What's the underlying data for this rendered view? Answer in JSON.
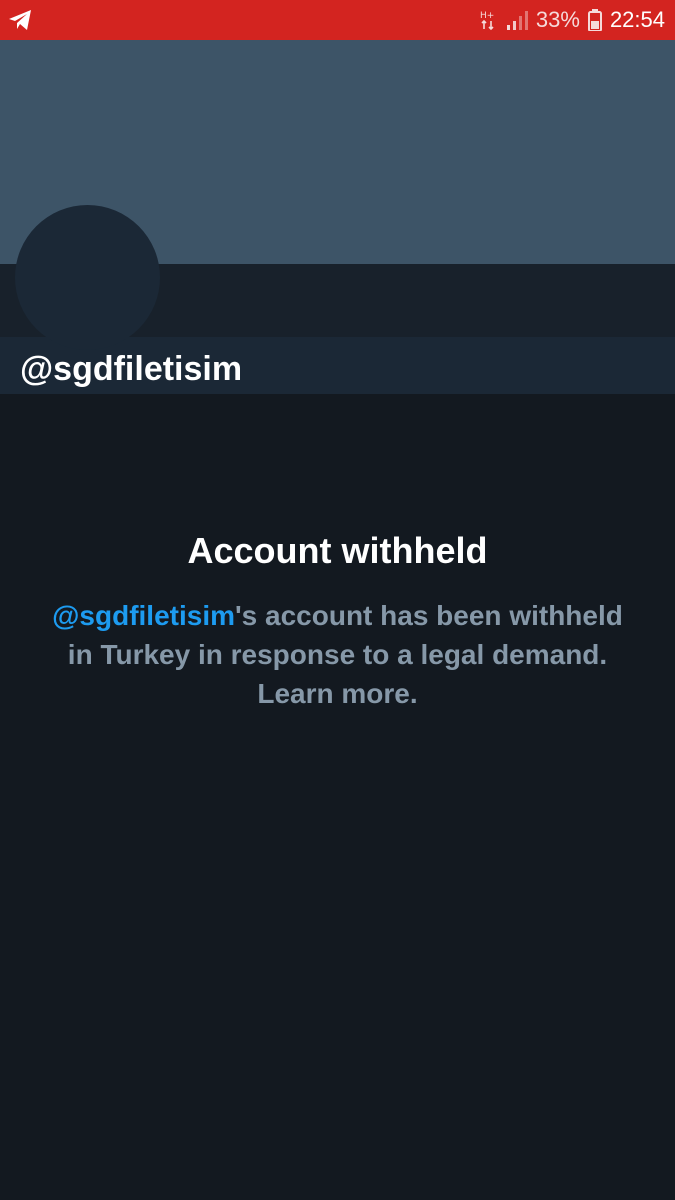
{
  "status_bar": {
    "network_type": "H+",
    "battery_percent": "33%",
    "time": "22:54"
  },
  "profile": {
    "handle": "@sgdfiletisim"
  },
  "withheld": {
    "title": "Account withheld",
    "mention": "@sgdfiletisim",
    "message_text": "'s account has been withheld in Turkey in response to a legal demand.",
    "learn_more": "Learn more."
  },
  "colors": {
    "status_bar": "#d32420",
    "banner": "#3d5467",
    "background": "#131920",
    "link": "#1d9bf0",
    "muted_text": "#8698a8"
  }
}
